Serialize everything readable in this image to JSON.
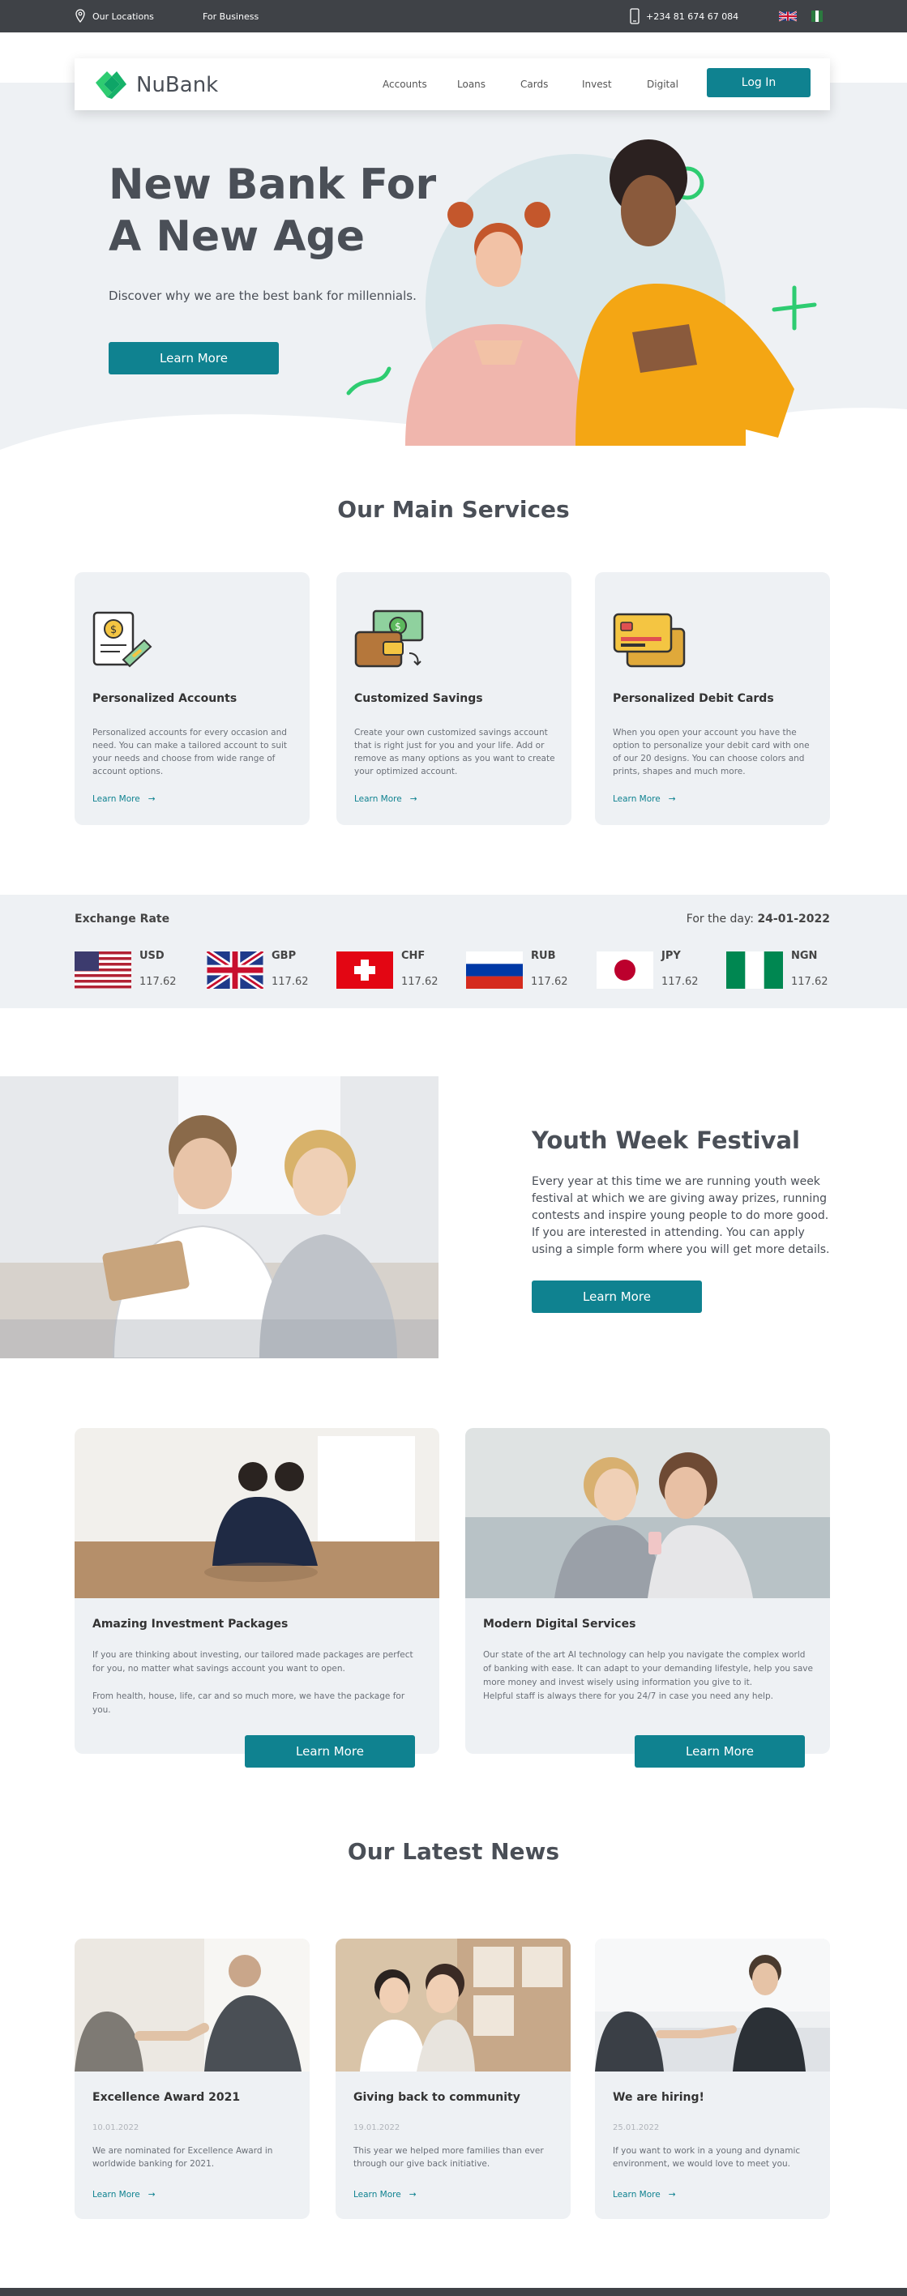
{
  "topbar": {
    "locations": "Our Locations",
    "business": "For Business",
    "phone": "+234 81 674 67 084"
  },
  "nav": {
    "brand": "NuBank",
    "links": [
      "Accounts",
      "Loans",
      "Cards",
      "Invest",
      "Digital"
    ],
    "login": "Log In"
  },
  "hero": {
    "title_line1": "New Bank For",
    "title_line2": "A New Age",
    "subtitle": "Discover why we are the best bank for millennials.",
    "cta": "Learn More"
  },
  "services": {
    "title": "Our Main Services",
    "items": [
      {
        "title": "Personalized Accounts",
        "text": "Personalized accounts for every occasion and need. You can make a tailored account to suit your needs and choose from wide range of account options.",
        "link": "Learn More",
        "icon": "document-coin-icon"
      },
      {
        "title": "Customized Savings",
        "text": "Create your own customized savings account that is right just for you and your life. Add or remove as many options as you want to create your optimized account.",
        "link": "Learn More",
        "icon": "wallet-money-icon"
      },
      {
        "title": "Personalized Debit Cards",
        "text": "When you open your account you have the option to personalize your debit card with one of our 20 designs. You can choose colors and prints, shapes and much more.",
        "link": "Learn More",
        "icon": "debit-cards-icon"
      }
    ]
  },
  "exchange": {
    "title": "Exchange Rate",
    "date_label": "For the day:",
    "date": "24-01-2022",
    "rates": [
      {
        "code": "USD",
        "rate": "117.62"
      },
      {
        "code": "GBP",
        "rate": "117.62"
      },
      {
        "code": "CHF",
        "rate": "117.62"
      },
      {
        "code": "RUB",
        "rate": "117.62"
      },
      {
        "code": "JPY",
        "rate": "117.62"
      },
      {
        "code": "NGN",
        "rate": "117.62"
      }
    ]
  },
  "youth": {
    "title": "Youth Week Festival",
    "text": "Every year at this time we are running youth week festival at which we are giving away prizes, running contests and inspire young people to do more good. If you are interested in attending. You can apply using a simple form where you will get more details.",
    "cta": "Learn More"
  },
  "packages": [
    {
      "title": "Amazing Investment Packages",
      "text1": "If you are thinking about investing, our tailored made packages are perfect for you, no matter what savings account you want to open.",
      "text2": "From health, house, life, car and so much more, we have the package for you.",
      "cta": "Learn More"
    },
    {
      "title": "Modern Digital Services",
      "text1": "Our state of the art AI technology can help you navigate the complex world of banking with ease. It can adapt to your demanding lifestyle, help you save more money and invest wisely using information you give to it.",
      "text2": "Helpful staff is always there for you 24/7 in case you need any help.",
      "cta": "Learn More"
    }
  ],
  "news": {
    "title": "Our Latest News",
    "items": [
      {
        "title": "Excellence Award 2021",
        "date": "10.01.2022",
        "text": "We are nominated for Excellence Award in worldwide banking for 2021.",
        "link": "Learn More"
      },
      {
        "title": "Giving back to community",
        "date": "19.01.2022",
        "text": "This year we helped more families than ever through our give back initiative.",
        "link": "Learn More"
      },
      {
        "title": "We are hiring!",
        "date": "25.01.2022",
        "text": "If you want to work in a young and dynamic environment, we would love to meet you.",
        "link": "Learn More"
      }
    ]
  },
  "colors": {
    "accent": "#0f8290",
    "brand_green": "#2ecc71",
    "surface": "#eef1f4",
    "dark": "#3f4247"
  }
}
